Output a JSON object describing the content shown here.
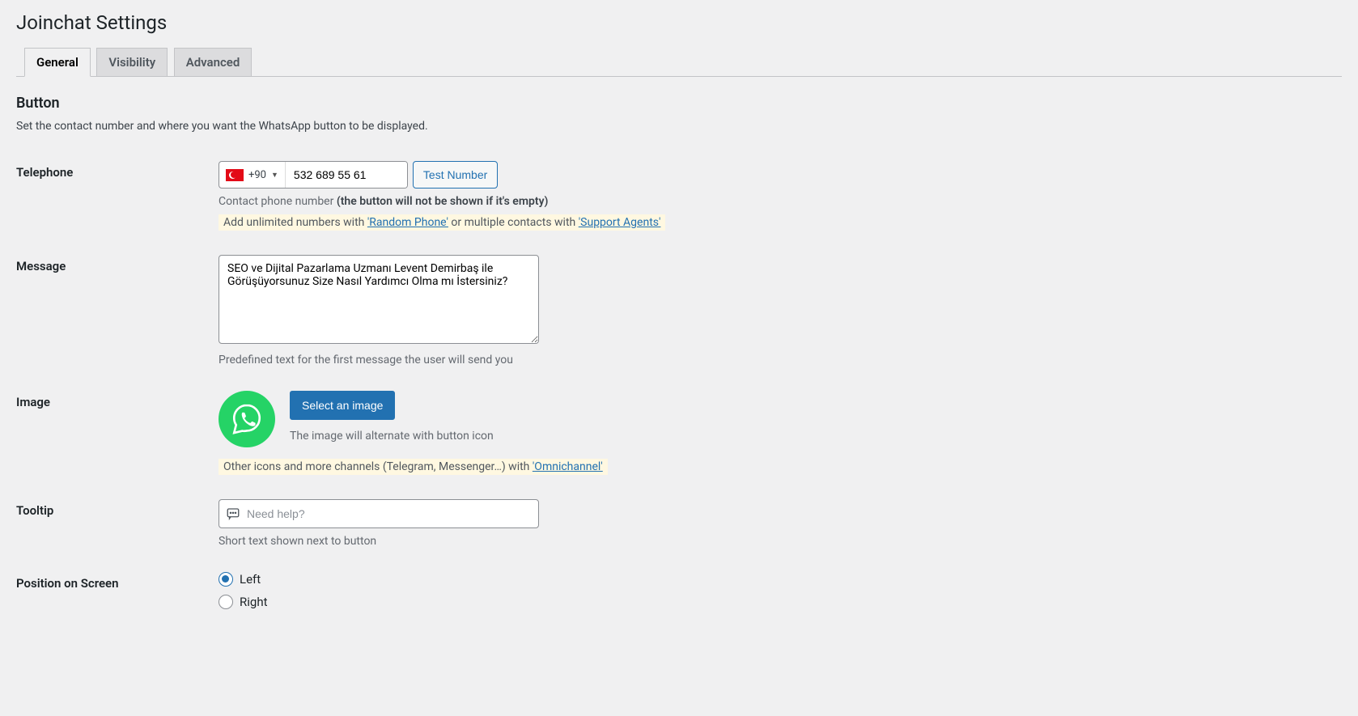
{
  "page_title": "Joinchat Settings",
  "tabs": [
    {
      "label": "General",
      "active": true
    },
    {
      "label": "Visibility",
      "active": false
    },
    {
      "label": "Advanced",
      "active": false
    }
  ],
  "section": {
    "heading": "Button",
    "description": "Set the contact number and where you want the WhatsApp button to be displayed."
  },
  "telephone": {
    "label": "Telephone",
    "dial_code": "+90",
    "number": "532 689 55 61",
    "test_button": "Test Number",
    "help_prefix": "Contact phone number ",
    "help_strong": "(the button will not be shown if it's empty)",
    "note_pre": "Add unlimited numbers with ",
    "note_link1": "'Random Phone'",
    "note_mid": " or multiple contacts with ",
    "note_link2": "'Support Agents'"
  },
  "message": {
    "label": "Message",
    "value": "SEO ve Dijital Pazarlama Uzmanı Levent Demirbaş ile Görüşüyorsunuz Size Nasıl Yardımcı Olma mı İstersiniz?",
    "help": "Predefined text for the first message the user will send you"
  },
  "image": {
    "label": "Image",
    "button": "Select an image",
    "help": "The image will alternate with button icon",
    "note_pre": "Other icons and more channels (Telegram, Messenger…) with ",
    "note_link": "'Omnichannel'"
  },
  "tooltip": {
    "label": "Tooltip",
    "placeholder": "Need help?",
    "value": "",
    "help": "Short text shown next to button"
  },
  "position": {
    "label": "Position on Screen",
    "options": [
      {
        "label": "Left",
        "checked": true
      },
      {
        "label": "Right",
        "checked": false
      }
    ]
  }
}
